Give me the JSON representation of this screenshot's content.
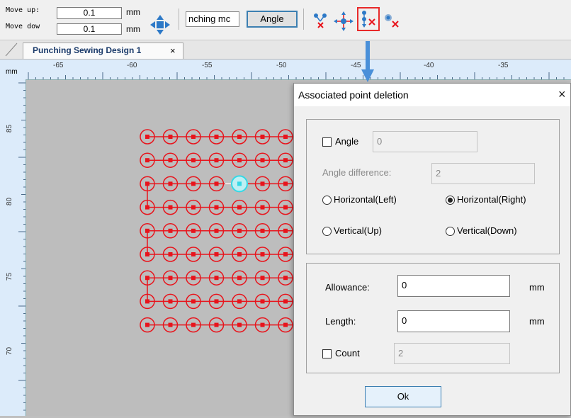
{
  "toolbar": {
    "move_up_label": "Move up:",
    "move_down_label": "Move dow",
    "move_up_value": "0.1",
    "move_down_value": "0.1",
    "unit": "mm",
    "mode_dropdown_value": "nching mc",
    "angle_button_label": "Angle"
  },
  "tabs": [
    {
      "label": "Punching Sewing Design 1",
      "close": "×"
    }
  ],
  "ruler": {
    "unit": "mm",
    "top_labels": [
      "-65",
      "-60",
      "-55",
      "-50",
      "-45",
      "-40",
      "-35"
    ],
    "left_labels": [
      "85",
      "80",
      "75",
      "70"
    ]
  },
  "dialog": {
    "title": "Associated point deletion",
    "close": "×",
    "angle": {
      "label": "Angle",
      "value": "0",
      "checked": false
    },
    "angle_difference": {
      "label": "Angle difference:",
      "value": "2"
    },
    "radios": [
      {
        "label": "Horizontal(Left)",
        "selected": false
      },
      {
        "label": "Horizontal(Right)",
        "selected": true
      },
      {
        "label": "Vertical(Up)",
        "selected": false
      },
      {
        "label": "Vertical(Down)",
        "selected": false
      }
    ],
    "allowance": {
      "label": "Allowance:",
      "value": "0",
      "unit": "mm"
    },
    "length": {
      "label": "Length:",
      "value": "0",
      "unit": "mm"
    },
    "count": {
      "label": "Count",
      "value": "2",
      "checked": false
    },
    "ok_label": "Ok"
  },
  "colors": {
    "accent": "#3c7fb1",
    "point_red": "#e8141c",
    "selected_point": "#34d9e6",
    "highlight_box": "#e82a2a"
  },
  "canvas": {
    "point_rows": 9,
    "point_cols": 7,
    "selected_point": {
      "row": 2,
      "col": 4
    }
  }
}
